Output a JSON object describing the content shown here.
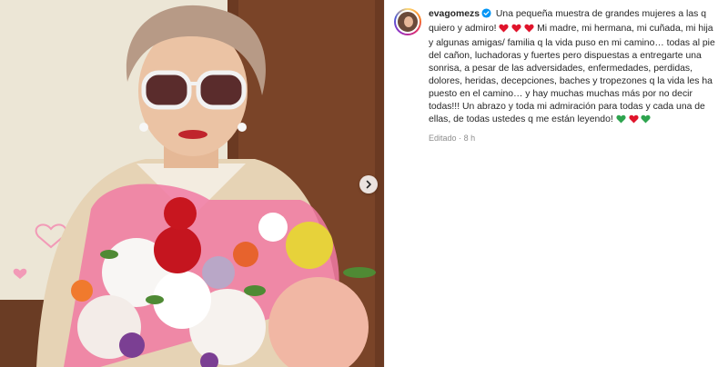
{
  "post": {
    "username": "evagomezs",
    "caption_part1": "Una pequeña muestra de grandes mujeres a las q quiero y admiro!",
    "caption_part2": "Mi madre, mi hermana, mi cuñada, mi hija y algunas amigas/ familia q la vida puso en mi camino… todas al pie del cañon, luchadoras y fuertes pero dispuestas a entregarte una sonrisa, a pesar de las adversidades, enfermedades, perdidas, dolores, heridas, decepciones, baches y tropezones q la vida les ha puesto en el camino… y hay muchas muchas más por no decir todas!!! Un abrazo y toda mi admiración para todas y cada una de ellas, de todas ustedes q me están leyendo!",
    "edited_label": "Editado",
    "separator": "·",
    "time": "8 h"
  },
  "icons": {
    "verified": "verified-badge-icon",
    "red_heart": "red-heart-emoji",
    "green_heart": "green-heart-emoji",
    "next": "chevron-right-icon"
  },
  "colors": {
    "verified_blue": "#0095f6",
    "heart_red": "#e0142b",
    "heart_green": "#2ea44f",
    "text": "#262626",
    "secondary": "#8e8e8e"
  }
}
